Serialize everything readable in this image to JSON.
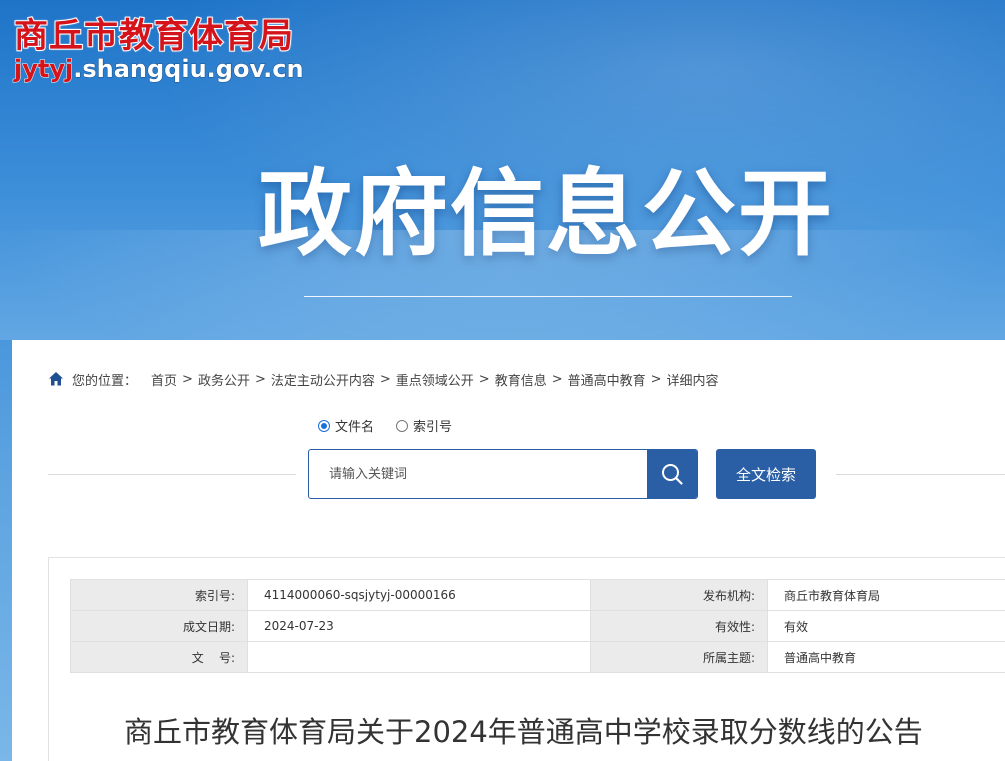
{
  "header": {
    "site_name": "商丘市教育体育局",
    "site_url_prefix": "jytyj",
    "site_url_suffix": ".shangqiu.gov.cn",
    "banner_title": "政府信息公开"
  },
  "breadcrumb": {
    "label": "您的位置：",
    "items": [
      "首页",
      "政务公开",
      "法定主动公开内容",
      "重点领域公开",
      "教育信息",
      "普通高中教育",
      "详细内容"
    ],
    "separator": ">"
  },
  "search": {
    "options": [
      {
        "label": "文件名",
        "checked": true
      },
      {
        "label": "索引号",
        "checked": false
      }
    ],
    "placeholder": "请输入关键词",
    "fulltext_label": "全文检索"
  },
  "info": {
    "index_label": "索引号:",
    "index_value": "4114000060-sqsjytyj-00000166",
    "publisher_label": "发布机构:",
    "publisher_value": "商丘市教育体育局",
    "date_label": "成文日期:",
    "date_value": "2024-07-23",
    "validity_label": "有效性:",
    "validity_value": "有效",
    "docno_label": "文    号:",
    "docno_value": "",
    "topic_label": "所属主题:",
    "topic_value": "普通高中教育"
  },
  "article": {
    "title": "商丘市教育体育局关于2024年普通高中学校录取分数线的公告"
  },
  "colors": {
    "primary": "#2a5ea5",
    "logo_red": "#d4141a",
    "banner_blue": "#2a7fd0"
  }
}
